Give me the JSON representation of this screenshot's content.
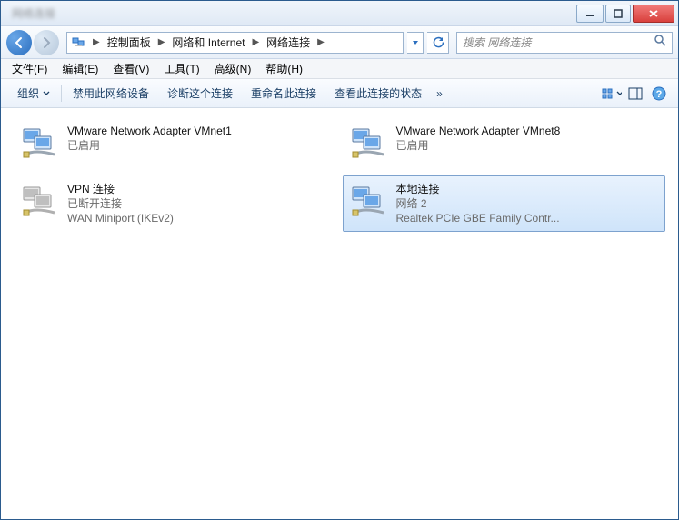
{
  "titlebar": {
    "blurred_text_left": "网络连接",
    "min_tip": "最小化",
    "max_tip": "最大化",
    "close_tip": "关闭"
  },
  "breadcrumbs": {
    "items": [
      "",
      "控制面板",
      "网络和 Internet",
      "网络连接"
    ]
  },
  "address": {
    "refresh_tip": "刷新"
  },
  "search": {
    "placeholder": "搜索 网络连接"
  },
  "menubar": {
    "file": "文件(F)",
    "edit": "编辑(E)",
    "view": "查看(V)",
    "tools": "工具(T)",
    "advanced": "高级(N)",
    "help": "帮助(H)"
  },
  "toolbar": {
    "organize": "组织",
    "disable": "禁用此网络设备",
    "diagnose": "诊断这个连接",
    "rename": "重命名此连接",
    "status": "查看此连接的状态",
    "overflow": "»"
  },
  "connections": [
    {
      "name": "VMware Network Adapter VMnet1",
      "status": "已启用",
      "detail": "",
      "selected": false
    },
    {
      "name": "VMware Network Adapter VMnet8",
      "status": "已启用",
      "detail": "",
      "selected": false
    },
    {
      "name": "VPN 连接",
      "status": "已断开连接",
      "detail": "WAN Miniport (IKEv2)",
      "selected": false
    },
    {
      "name": "本地连接",
      "status": "网络  2",
      "detail": "Realtek PCIe GBE Family Contr...",
      "selected": true
    }
  ]
}
